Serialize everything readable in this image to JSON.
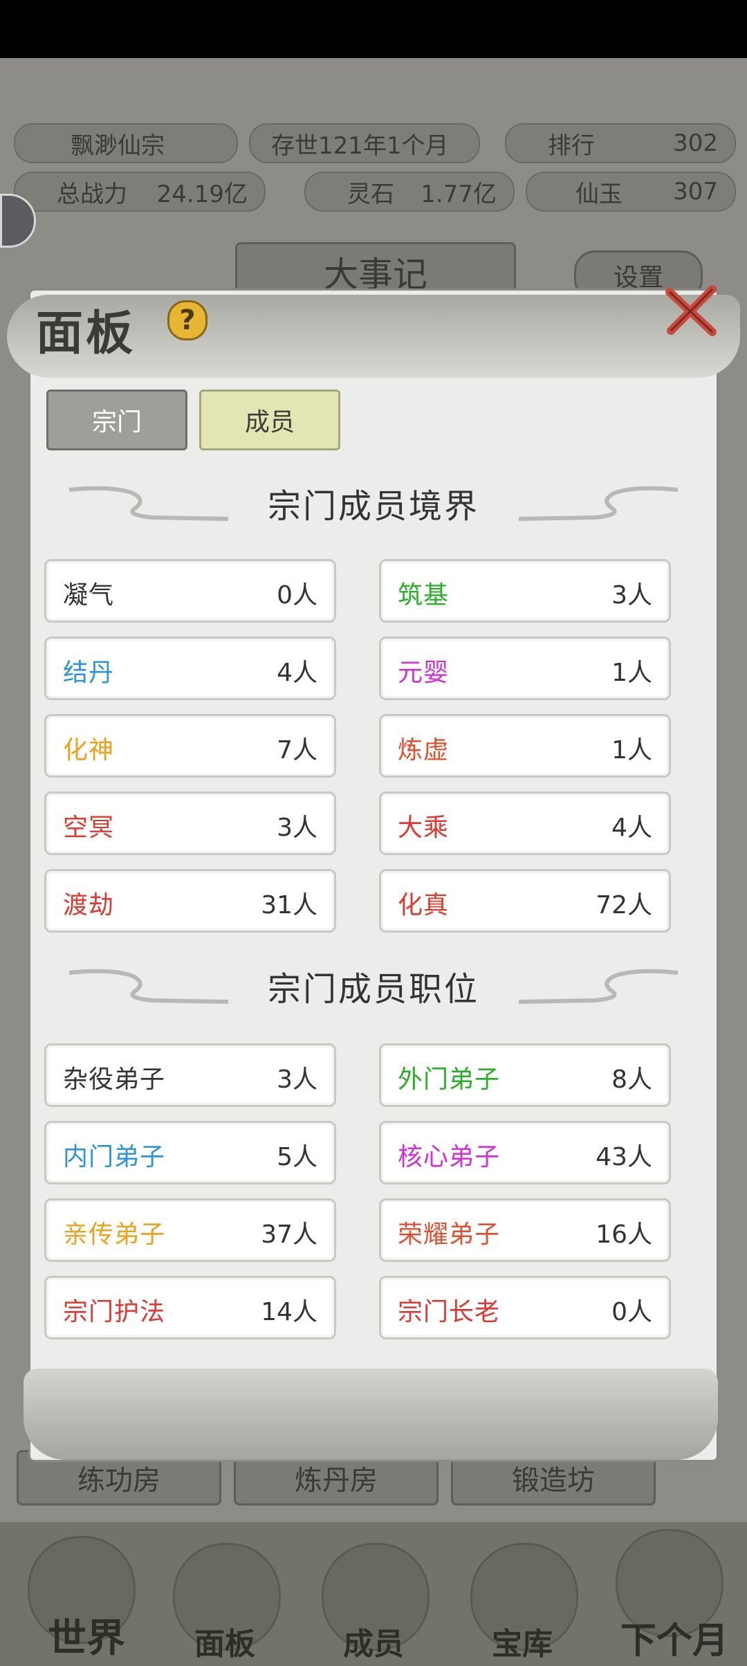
{
  "top": {
    "sect_name": "飘渺仙宗",
    "age": "存世121年1个月",
    "rank_label": "排行",
    "rank_value": "302",
    "power_label": "总战力",
    "power_value": "24.19亿",
    "spirit_stone_label": "灵石",
    "spirit_stone_value": "1.77亿",
    "jade_label": "仙玉",
    "jade_value": "307",
    "events_title": "大事记",
    "settings_label": "设置"
  },
  "panel": {
    "title": "面板",
    "help_icon": "?",
    "tabs": [
      {
        "label": "宗门",
        "selected": false
      },
      {
        "label": "成员",
        "selected": true
      }
    ],
    "realm_title": "宗门成员境界",
    "realms": [
      {
        "label": "凝气",
        "count": "0人",
        "color": "#333333"
      },
      {
        "label": "筑基",
        "count": "3人",
        "color": "#27b024"
      },
      {
        "label": "结丹",
        "count": "4人",
        "color": "#2a95d8"
      },
      {
        "label": "元婴",
        "count": "1人",
        "color": "#d52dd8"
      },
      {
        "label": "化神",
        "count": "7人",
        "color": "#eea21c"
      },
      {
        "label": "炼虚",
        "count": "1人",
        "color": "#e0502e"
      },
      {
        "label": "空冥",
        "count": "3人",
        "color": "#e0382e"
      },
      {
        "label": "大乘",
        "count": "4人",
        "color": "#e0382e"
      },
      {
        "label": "渡劫",
        "count": "31人",
        "color": "#e0382e"
      },
      {
        "label": "化真",
        "count": "72人",
        "color": "#e0382e"
      }
    ],
    "position_title": "宗门成员职位",
    "positions": [
      {
        "label": "杂役弟子",
        "count": "3人",
        "color": "#333333"
      },
      {
        "label": "外门弟子",
        "count": "8人",
        "color": "#27b024"
      },
      {
        "label": "内门弟子",
        "count": "5人",
        "color": "#2a95d8"
      },
      {
        "label": "核心弟子",
        "count": "43人",
        "color": "#d52dd8"
      },
      {
        "label": "亲传弟子",
        "count": "37人",
        "color": "#eea21c"
      },
      {
        "label": "荣耀弟子",
        "count": "16人",
        "color": "#e0502e"
      },
      {
        "label": "宗门护法",
        "count": "14人",
        "color": "#e0382e"
      },
      {
        "label": "宗门长老",
        "count": "0人",
        "color": "#e0382e"
      }
    ]
  },
  "bottom_buildings": [
    "练功房",
    "炼丹房",
    "锻造坊"
  ],
  "nav": [
    {
      "label": "世界"
    },
    {
      "label": "面板"
    },
    {
      "label": "成员"
    },
    {
      "label": "宝库"
    },
    {
      "label": "下个月"
    }
  ]
}
